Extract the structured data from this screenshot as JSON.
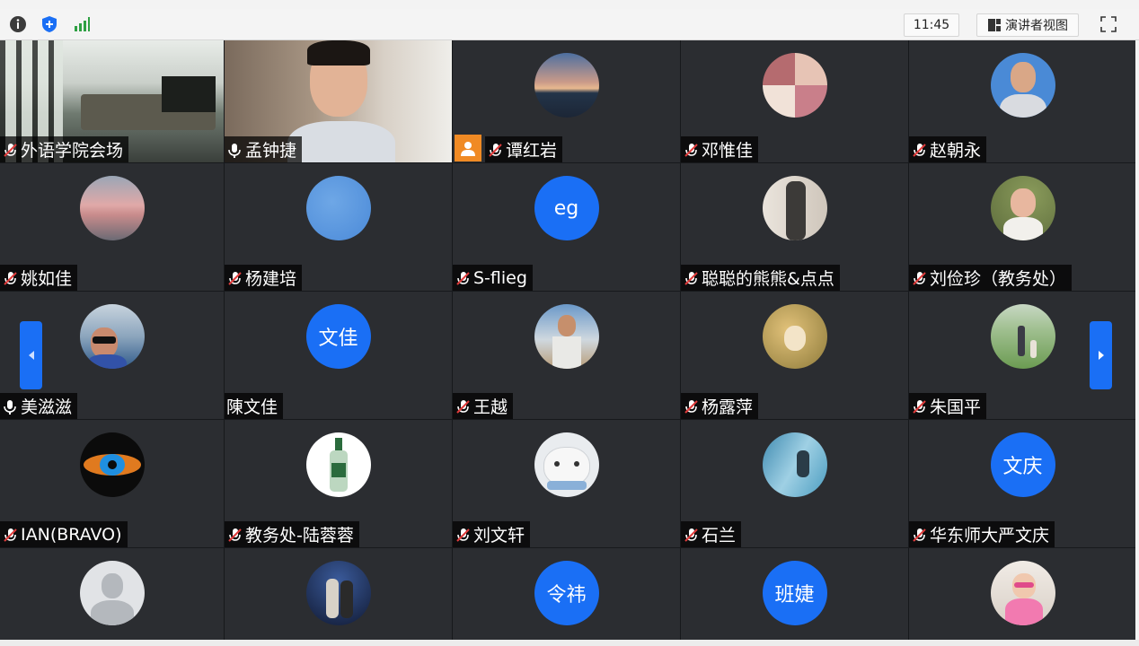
{
  "topbar": {
    "time": "11:45",
    "presenter_view_label": "演讲者视图"
  },
  "participants": [
    {
      "name": "外语学院会场",
      "mic": "muted",
      "video": "room"
    },
    {
      "name": "孟钟捷",
      "mic": "on",
      "video": "person"
    },
    {
      "name": "谭红岩",
      "mic": "muted",
      "avatar": "sunset"
    },
    {
      "name": "邓惟佳",
      "mic": "muted",
      "avatar": "collage"
    },
    {
      "name": "赵朝永",
      "mic": "muted",
      "avatar": "man"
    },
    {
      "name": "姚如佳",
      "mic": "muted",
      "avatar": "pink-sky"
    },
    {
      "name": "杨建培",
      "mic": "muted",
      "avatar": "blue-sky"
    },
    {
      "name": "S-flieg",
      "mic": "muted",
      "avatar_text": "eg"
    },
    {
      "name": "聪聪的熊熊&点点",
      "mic": "muted",
      "avatar": "person-dark"
    },
    {
      "name": "刘俭珍（教务处）",
      "mic": "muted",
      "avatar": "girl"
    },
    {
      "name": "美滋滋",
      "mic": "on",
      "avatar": "woman-sunglasses"
    },
    {
      "name": "陳文佳",
      "mic": "none",
      "avatar_text": "文佳"
    },
    {
      "name": "王越",
      "mic": "muted",
      "avatar": "man-outdoor"
    },
    {
      "name": "杨露萍",
      "mic": "muted",
      "avatar": "child-golden"
    },
    {
      "name": "朱国平",
      "mic": "muted",
      "avatar": "park"
    },
    {
      "name": "IAN(BRAVO)",
      "mic": "muted",
      "avatar": "eye"
    },
    {
      "name": "教务处-陆蓉蓉",
      "mic": "muted",
      "avatar": "bottle"
    },
    {
      "name": "刘文轩",
      "mic": "muted",
      "avatar": "cat"
    },
    {
      "name": "石兰",
      "mic": "muted",
      "avatar": "waterfall"
    },
    {
      "name": "华东师大严文庆",
      "mic": "muted",
      "avatar_text": "文庆"
    },
    {
      "name": "",
      "mic": "none",
      "avatar": "default-user"
    },
    {
      "name": "",
      "mic": "none",
      "avatar": "night-couple"
    },
    {
      "name": "",
      "mic": "none",
      "avatar_text": "令祎"
    },
    {
      "name": "",
      "mic": "none",
      "avatar_text": "班婕"
    },
    {
      "name": "",
      "mic": "none",
      "avatar": "kid-pink"
    }
  ],
  "colors": {
    "accent": "#1a6ff5",
    "tile_bg": "#2b2d31",
    "host_badge": "#f08a24",
    "signal_green": "#2ea043"
  },
  "icons": {
    "info": "info-icon",
    "shield": "shield-icon",
    "signal": "signal-icon",
    "layout": "layout-icon",
    "fullscreen": "fullscreen-icon",
    "mic_muted": "mic-muted-icon",
    "mic_on": "mic-icon",
    "host": "host-icon",
    "prev": "chevron-left-icon",
    "next": "chevron-right-icon"
  }
}
